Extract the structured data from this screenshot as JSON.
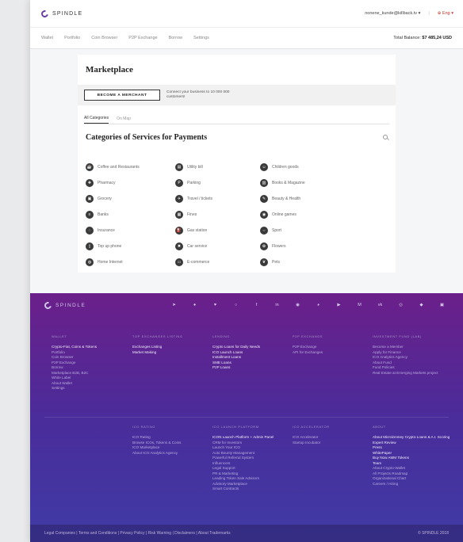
{
  "brand": "SPINDLE",
  "header": {
    "email": "nonene_kunde@killback.tv",
    "language": "Eng"
  },
  "nav": {
    "items": [
      "Wallet",
      "Portfolio",
      "Coin Browser",
      "P2P Exchange",
      "Borrow",
      "Settings"
    ],
    "balance_label": "Total Balance:",
    "balance_value": "$7 485,24 USD"
  },
  "marketplace": {
    "title": "Marketplace",
    "merchant_button": "BECOME A MERCHANT",
    "merchant_text": "Connect your business to 10 000 000 customers!",
    "tabs": [
      "All Categories",
      "On Map"
    ],
    "categories_title": "Categories of Services for Payments",
    "categories": [
      {
        "label": "Coffee and Restaurants",
        "icon": "coffee-icon"
      },
      {
        "label": "Utility bill",
        "icon": "bill-icon"
      },
      {
        "label": "Children goods",
        "icon": "children-icon"
      },
      {
        "label": "Pharmacy",
        "icon": "pharmacy-icon"
      },
      {
        "label": "Parking",
        "icon": "parking-icon"
      },
      {
        "label": "Books & Magazine",
        "icon": "book-icon"
      },
      {
        "label": "Grocery",
        "icon": "grocery-icon"
      },
      {
        "label": "Travel / tickets",
        "icon": "travel-icon"
      },
      {
        "label": "Beauty & Health",
        "icon": "beauty-icon"
      },
      {
        "label": "Banks",
        "icon": "bank-icon"
      },
      {
        "label": "Fines",
        "icon": "fines-icon"
      },
      {
        "label": "Online games",
        "icon": "gamepad-icon"
      },
      {
        "label": "Insurance",
        "icon": "insurance-icon"
      },
      {
        "label": "Gas station",
        "icon": "gas-icon"
      },
      {
        "label": "Sport",
        "icon": "sport-icon"
      },
      {
        "label": "Top up phone",
        "icon": "phone-icon"
      },
      {
        "label": "Car service",
        "icon": "car-service-icon"
      },
      {
        "label": "Flowers",
        "icon": "flower-icon"
      },
      {
        "label": "Home Internet",
        "icon": "internet-icon"
      },
      {
        "label": "E-commerce",
        "icon": "ecommerce-icon"
      },
      {
        "label": "Pets",
        "icon": "pet-icon"
      }
    ]
  },
  "footer": {
    "socials": [
      "telegram-icon",
      "reddit-icon",
      "twitter-icon",
      "github-icon",
      "facebook-icon",
      "linkedin-icon",
      "medium-icon",
      "weibo-icon",
      "youtube-icon",
      "medium-m-icon",
      "vk-icon",
      "instagram-icon",
      "chat-icon",
      "bitcointalk-icon"
    ],
    "columns_top": [
      {
        "heading": "WALLET",
        "links": [
          "Crypto-Fiat, Coins & Tokens",
          "Portfolio",
          "Coin Browser",
          "P2P Exchange",
          "Borrow",
          "Marketplace B2B, B2C",
          "White Label",
          "About Wallet",
          "Settings"
        ]
      },
      {
        "heading": "TOP EXCHANGES LISTING",
        "links": [
          "Exchanges Listing",
          "Market Making"
        ]
      },
      {
        "heading": "LENDING",
        "links": [
          "Crypto Loans for Daily Needs",
          "ICO Launch Loans",
          "Installment Loans",
          "SME Loans",
          "P2P Loans"
        ]
      },
      {
        "heading": "P2P EXCHANGE",
        "links": [
          "P2P Exchange",
          "API for Exchanges"
        ]
      },
      {
        "heading": "INVESTMENT FUND (LAB)",
        "links": [
          "Become a Member",
          "Apply for Finance",
          "ICO Analytics Agency",
          "About Fund",
          "Fund Policies",
          "Real Estate at Emerging Markets project"
        ]
      }
    ],
    "columns_bottom": [
      {
        "heading": "ICO RATING",
        "links": [
          "ICO Rating",
          "Browse ICOs, Tokens & Coins",
          "ICO Marketplace",
          "About ICO Analytics Agency"
        ]
      },
      {
        "heading": "ICO LAUNCH PLATFORM",
        "links": [
          "ICON Launch Platform + Admin Panel",
          "CRM for Investors",
          "Launch Your ICO",
          "Auto Bounty Management",
          "Powerful Referral System",
          "Influencers",
          "Legal Support",
          "PR & Marketing",
          "Leading Token Sale Advisors",
          "Advisory Marketplace",
          "Smart Contracts"
        ]
      },
      {
        "heading": "ICO ACCELERATOR",
        "links": [
          "ICO Accelerator",
          "Startup Incubator"
        ]
      },
      {
        "heading": "ABOUT",
        "links": [
          "About Microinnmey Crypto-Loans & A.I. Scoring",
          "Expert Review",
          "Press",
          "WhitePaper",
          "Buy Now AMM Tokens",
          "Team",
          "About Crypto-Wallet",
          "All Projects Roadmap",
          "Organizational Chart",
          "Careers / Hiring"
        ]
      }
    ],
    "legal": "Legal Companies | Terms and Conditions | Privacy Policy | Risk Warning | Disclaimers | About Trademarks",
    "copyright": "© SPINDLE 2018"
  }
}
